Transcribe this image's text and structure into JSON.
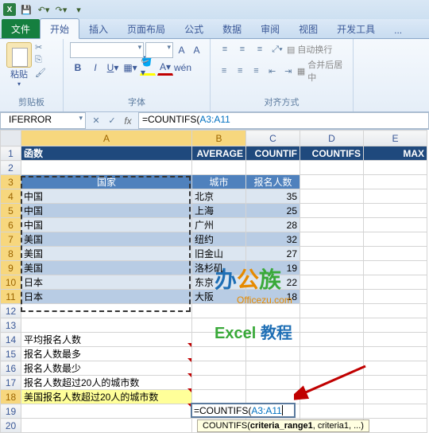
{
  "qat": {
    "save": "保存",
    "undo": "撤销",
    "redo": "重做"
  },
  "tabs": {
    "file": "文件",
    "home": "开始",
    "insert": "插入",
    "layout": "页面布局",
    "formulas": "公式",
    "data": "数据",
    "review": "审阅",
    "view": "视图",
    "dev": "开发工具",
    "more": "..."
  },
  "ribbon": {
    "paste": "粘贴",
    "clipboard": "剪贴板",
    "font_group": "字体",
    "align_group": "对齐方式",
    "wrap": "自动换行",
    "merge": "合并后居中"
  },
  "namebox": "IFERROR",
  "formula": {
    "prefix": "=COUNTIFS(",
    "ref": "A3:A11"
  },
  "cols": [
    "A",
    "B",
    "C",
    "D",
    "E"
  ],
  "row1": {
    "label": "函数",
    "b": "AVERAGE",
    "c": "COUNTIF",
    "d": "COUNTIFS",
    "e": "MAX"
  },
  "tblhdr": {
    "a": "国家",
    "b": "城市",
    "c": "报名人数"
  },
  "rows": [
    {
      "a": "中国",
      "b": "北京",
      "c": 35
    },
    {
      "a": "中国",
      "b": "上海",
      "c": 25
    },
    {
      "a": "中国",
      "b": "广州",
      "c": 28
    },
    {
      "a": "美国",
      "b": "纽约",
      "c": 32
    },
    {
      "a": "美国",
      "b": "旧金山",
      "c": 27
    },
    {
      "a": "美国",
      "b": "洛杉矶",
      "c": 19
    },
    {
      "a": "日本",
      "b": "东京",
      "c": 22
    },
    {
      "a": "日本",
      "b": "大阪",
      "c": 18
    }
  ],
  "labels": {
    "r14": "平均报名人数",
    "r15": "报名人数最多",
    "r16": "报名人数最少",
    "r17": "报名人数超过20人的城市数",
    "r18": "美国报名人数超过20人的城市数"
  },
  "edit": {
    "text": "=COUNTIFS(",
    "ref": "A3:A11"
  },
  "tooltip": {
    "fn": "COUNTIFS(",
    "arg1": "criteria_range1",
    "rest": ", criteria1, ...)"
  },
  "watermark": {
    "brand": "办公族",
    "url": "Officezu.com",
    "sub1": "Excel",
    "sub2": " 教程"
  }
}
